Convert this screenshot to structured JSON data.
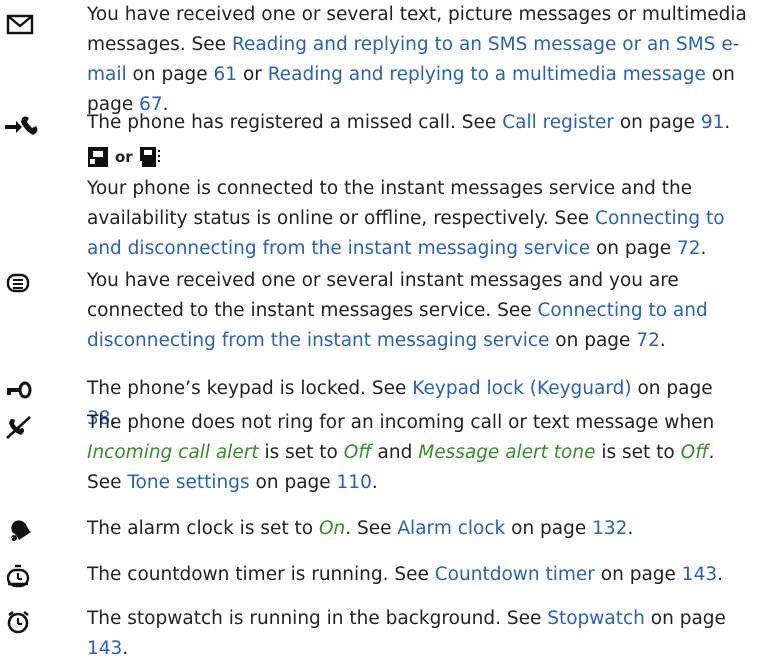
{
  "entries": [
    {
      "icon": "envelope-icon",
      "parts": [
        {
          "t": "You have received one or several text, picture messages or multimedia messages. See "
        },
        {
          "t": "Reading and replying to an SMS message or an SMS e-mail",
          "c": "link"
        },
        {
          "t": " on page "
        },
        {
          "t": "61",
          "c": "link"
        },
        {
          "t": " or "
        },
        {
          "t": "Reading and replying to a multimedia message",
          "c": "link"
        },
        {
          "t": " on page "
        },
        {
          "t": "67",
          "c": "link"
        },
        {
          "t": "."
        }
      ]
    },
    {
      "icon": "missed-call-icon",
      "parts": [
        {
          "t": "The phone has registered a missed call. See "
        },
        {
          "t": "Call register",
          "c": "link"
        },
        {
          "t": " on page "
        },
        {
          "t": "91",
          "c": "link"
        },
        {
          "t": "."
        }
      ]
    },
    {
      "icon": null,
      "inline_or": "or",
      "inline_icons": [
        "im-online-icon",
        "im-offline-icon"
      ],
      "parts": [
        {
          "t": "Your phone is connected to the instant messages service and the availability status is online or offline, respectively. See "
        },
        {
          "t": "Connecting to and disconnecting from the instant messaging service",
          "c": "link"
        },
        {
          "t": " on page "
        },
        {
          "t": "72",
          "c": "link"
        },
        {
          "t": "."
        }
      ]
    },
    {
      "icon": "instant-message-icon",
      "parts": [
        {
          "t": "You have received one or several instant messages and you are connected to the instant messages service. See "
        },
        {
          "t": "Connecting to and disconnecting from the instant messaging service",
          "c": "link"
        },
        {
          "t": " on page "
        },
        {
          "t": "72",
          "c": "link"
        },
        {
          "t": "."
        }
      ]
    },
    {
      "icon": "keypad-lock-icon",
      "parts": [
        {
          "t": "The phone’s keypad is locked. See "
        },
        {
          "t": "Keypad lock (Keyguard)",
          "c": "link"
        },
        {
          "t": " on page "
        },
        {
          "t": "38",
          "c": "link"
        },
        {
          "t": "."
        }
      ]
    },
    {
      "icon": "silent-icon",
      "parts": [
        {
          "t": "The phone does not ring for an incoming call or text message when "
        },
        {
          "t": "Incoming call alert",
          "c": "em"
        },
        {
          "t": " is set to "
        },
        {
          "t": "Off",
          "c": "em"
        },
        {
          "t": " and "
        },
        {
          "t": "Message alert tone",
          "c": "em"
        },
        {
          "t": " is set to "
        },
        {
          "t": "Off",
          "c": "em"
        },
        {
          "t": ". See "
        },
        {
          "t": "Tone settings",
          "c": "link"
        },
        {
          "t": " on page "
        },
        {
          "t": "110",
          "c": "link"
        },
        {
          "t": "."
        }
      ]
    },
    {
      "icon": "alarm-bell-icon",
      "parts": [
        {
          "t": "The alarm clock is set to "
        },
        {
          "t": "On",
          "c": "em"
        },
        {
          "t": ". See "
        },
        {
          "t": "Alarm clock",
          "c": "link"
        },
        {
          "t": " on page "
        },
        {
          "t": "132",
          "c": "link"
        },
        {
          "t": "."
        }
      ]
    },
    {
      "icon": "countdown-timer-icon",
      "parts": [
        {
          "t": "The countdown timer is running. See "
        },
        {
          "t": "Countdown timer",
          "c": "link"
        },
        {
          "t": " on page "
        },
        {
          "t": "143",
          "c": "link"
        },
        {
          "t": "."
        }
      ]
    },
    {
      "icon": "stopwatch-icon",
      "parts": [
        {
          "t": "The stopwatch is running in the background. See "
        },
        {
          "t": "Stopwatch",
          "c": "link"
        },
        {
          "t": " on page "
        },
        {
          "t": "143",
          "c": "link"
        },
        {
          "t": "."
        }
      ]
    }
  ]
}
